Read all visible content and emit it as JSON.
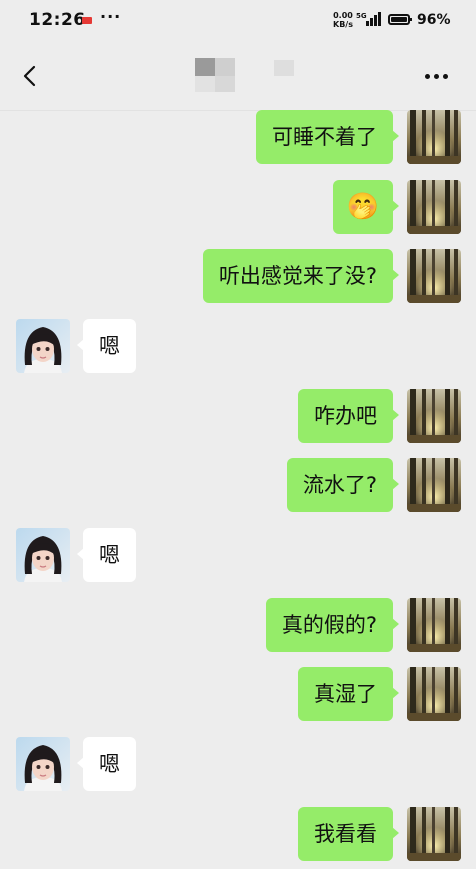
{
  "status_bar": {
    "time": "12:26",
    "network_speed_value": "0.00",
    "network_speed_unit": "KB/s",
    "network_type": "5G",
    "battery_percent": "96%",
    "battery_level": 0.96
  },
  "nav": {
    "back_icon": "chevron-left-icon",
    "title": "",
    "more_icon": "more-dots-icon"
  },
  "messages": [
    {
      "side": "right",
      "text": "可睡不着了"
    },
    {
      "side": "right",
      "text": "🤭"
    },
    {
      "side": "right",
      "text": "听出感觉来了没?"
    },
    {
      "side": "left",
      "text": "嗯"
    },
    {
      "side": "right",
      "text": "咋办吧"
    },
    {
      "side": "right",
      "text": "流水了?"
    },
    {
      "side": "left",
      "text": "嗯"
    },
    {
      "side": "right",
      "text": "真的假的?"
    },
    {
      "side": "right",
      "text": "真湿了"
    },
    {
      "side": "left",
      "text": "嗯"
    },
    {
      "side": "right",
      "text": "我看看"
    }
  ],
  "colors": {
    "background": "#ededed",
    "outgoing_bubble": "#95ec69",
    "incoming_bubble": "#ffffff"
  }
}
